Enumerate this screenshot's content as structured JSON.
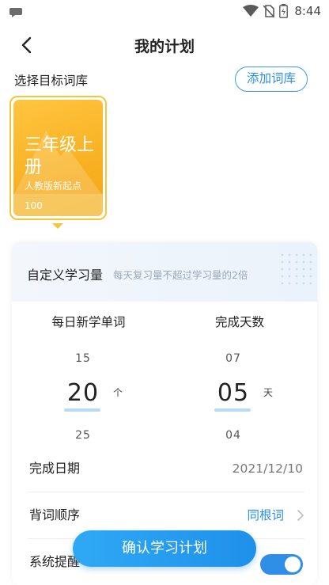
{
  "status_bar": {
    "time": "8:44",
    "icons": [
      "chat-bubble-icon",
      "wifi-icon",
      "no-sim-icon",
      "battery-icon"
    ]
  },
  "header": {
    "title": "我的计划",
    "back_icon": "chevron-left-icon"
  },
  "target_library": {
    "label": "选择目标词库",
    "add_button": "添加词库",
    "books": [
      {
        "title": "三年级上册",
        "subtitle": "人教版新起点",
        "count": "100",
        "selected": true
      }
    ]
  },
  "custom_plan": {
    "title": "自定义学习量",
    "hint": "每天复习量不超过学习量的2倍",
    "daily_words": {
      "label": "每日新学单词",
      "prev": "15",
      "current": "20",
      "next": "25",
      "unit": "个"
    },
    "days": {
      "label": "完成天数",
      "prev": "07",
      "current": "05",
      "next": "04",
      "unit": "天"
    }
  },
  "settings": {
    "finish_date": {
      "label": "完成日期",
      "value": "2021/12/10"
    },
    "order": {
      "label": "背词顺序",
      "value": "同根词"
    },
    "reminder": {
      "label": "系统提醒",
      "enabled": true
    }
  },
  "confirm_button": "确认学习计划",
  "colors": {
    "accent_blue": "#2a8fe0",
    "book_yellow": "#f7ae1f",
    "underline_blue": "#b7dcf5"
  }
}
